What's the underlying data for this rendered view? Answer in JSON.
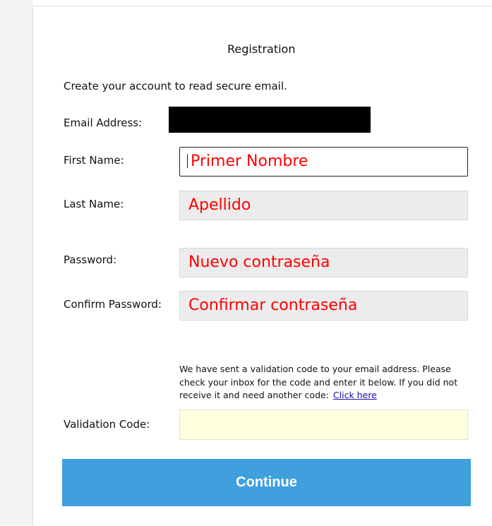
{
  "form": {
    "title": "Registration",
    "intro": "Create your account to read secure email.",
    "email_label": "Email Address:",
    "first_name": {
      "label": "First Name:",
      "value": "Primer Nombre"
    },
    "last_name": {
      "label": "Last Name:",
      "value": "Apellido"
    },
    "password": {
      "label": "Password:",
      "value": "Nuevo contraseña"
    },
    "confirm_password": {
      "label": "Confirm Password:",
      "value": "Confirmar contraseña"
    },
    "info_text": "We have sent a validation code to your email address. Please check your inbox for the code and enter it below. If you did not receive it and need another code:",
    "info_link": "Click here",
    "validation_label": "Validation Code:",
    "validation_value": "",
    "continue_label": "Continue"
  },
  "colors": {
    "button": "#3fa0dd",
    "field_text": "#ff0000",
    "validation_bg": "#ffffe0",
    "link": "#1a0dab"
  }
}
